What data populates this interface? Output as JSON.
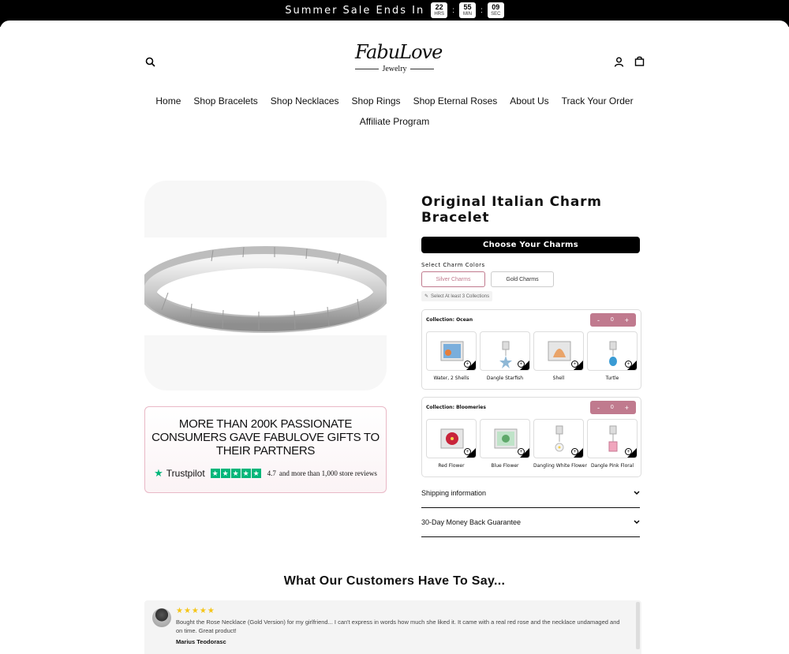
{
  "announcement": {
    "text": "Summer Sale Ends In",
    "countdown": [
      {
        "value": "22",
        "unit": "HRS"
      },
      {
        "value": "55",
        "unit": "MIN"
      },
      {
        "value": "09",
        "unit": "SEC"
      }
    ],
    "separator": ":"
  },
  "header": {
    "logo_script": "FabuLove",
    "logo_sub": "Jewelry"
  },
  "nav": {
    "row1": [
      "Home",
      "Shop Bracelets",
      "Shop Necklaces",
      "Shop Rings",
      "Shop Eternal Roses",
      "About Us",
      "Track Your Order"
    ],
    "row2": [
      "Affiliate Program"
    ]
  },
  "trust": {
    "headline": "MORE THAN 200K PASSIONATE CONSUMERS GAVE FABULOVE GIFTS TO THEIR PARTNERS",
    "brand": "Trustpilot",
    "rating": "4.7",
    "rating_text": "and more than 1,000 store reviews"
  },
  "product": {
    "title": "Original Italian Charm Bracelet",
    "choose_label": "Choose Your Charms",
    "select_label": "Select Charm Colors",
    "colors": [
      "Silver Charms",
      "Gold Charms"
    ],
    "hint": "Select At least 3 Collections",
    "collections": [
      {
        "title": "Collection: Ocean",
        "qty": "0",
        "charms": [
          "Water, 2 Shells",
          "Dangle Starfish",
          "Shell",
          "Turtle"
        ]
      },
      {
        "title": "Collection: Bloomeries",
        "qty": "0",
        "charms": [
          "Red Flower",
          "Blue Flower",
          "Dangling White Flower",
          "Dangle Pink Floral"
        ]
      }
    ],
    "accordions": [
      "Shipping information",
      "30-Day Money Back Guarantee"
    ]
  },
  "reviews": {
    "title": "What Our Customers Have To Say...",
    "items": [
      {
        "stars": "★★★★★",
        "text": "Bought the Rose Necklace (Gold Version) for my girlfriend... I can't express in words how much she liked it. It came with a real red rose and the necklace undamaged and on time. Great product!",
        "author": "Marius Teodorasc"
      }
    ]
  },
  "colors": {
    "accent": "#c07a8e",
    "trustpilot": "#00b67a",
    "star": "#f5c518"
  }
}
